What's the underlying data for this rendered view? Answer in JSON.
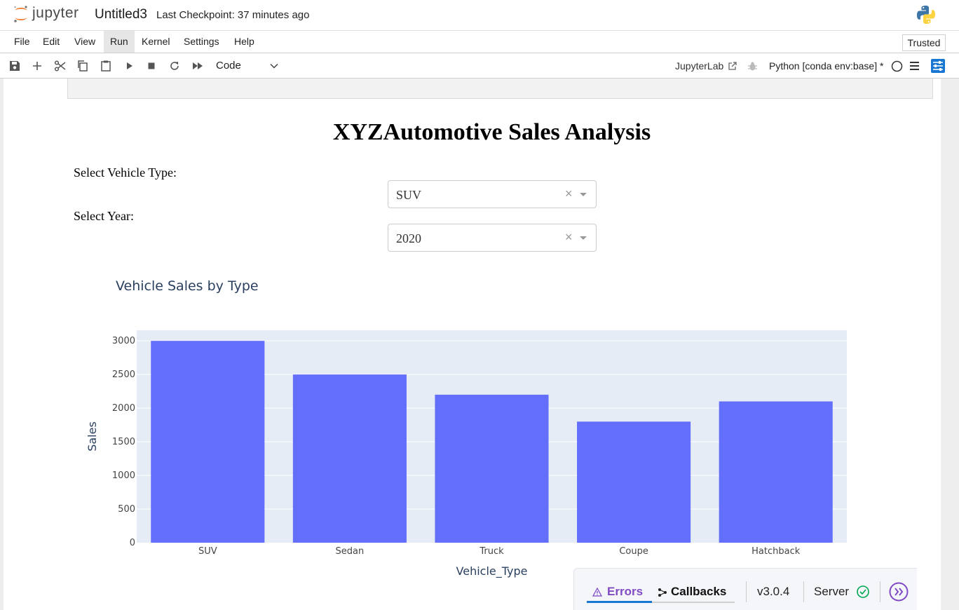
{
  "app": {
    "logo_text": "jupyter",
    "notebook_title": "Untitled3",
    "checkpoint": "Last Checkpoint: 37 minutes ago"
  },
  "menu": {
    "items": [
      "File",
      "Edit",
      "View",
      "Run",
      "Kernel",
      "Settings",
      "Help"
    ],
    "active": "Run",
    "trusted": "Trusted"
  },
  "toolbar": {
    "cell_type": "Code",
    "jupyterlab_link": "JupyterLab",
    "kernel": "Python [conda env:base] *"
  },
  "dash_app": {
    "title": "XYZAutomotive Sales Analysis",
    "vehicle_type_label": "Select Vehicle Type:",
    "vehicle_type_value": "SUV",
    "year_label": "Select Year:",
    "year_value": "2020",
    "clear_glyph": "×"
  },
  "chart_data": {
    "type": "bar",
    "title": "Vehicle Sales by Type",
    "xlabel": "Vehicle_Type",
    "ylabel": "Sales",
    "categories": [
      "SUV",
      "Sedan",
      "Truck",
      "Coupe",
      "Hatchback"
    ],
    "values": [
      3000,
      2500,
      2200,
      1800,
      2100
    ],
    "yticks": [
      0,
      500,
      1000,
      1500,
      2000,
      2500,
      3000
    ],
    "ylim": [
      0,
      3158
    ],
    "bar_color": "#636efa",
    "plot_bg": "#e5ecf6",
    "grid": true
  },
  "dash_debug": {
    "errors": "Errors",
    "callbacks": "Callbacks",
    "version": "v3.0.4",
    "server": "Server",
    "accent": "#7f4bc4",
    "ok_color": "#00a651"
  }
}
